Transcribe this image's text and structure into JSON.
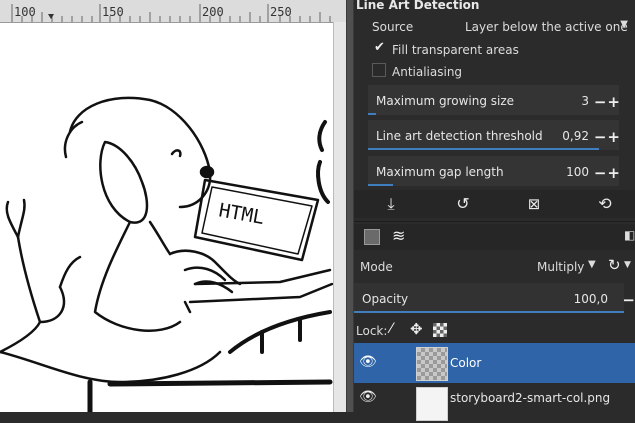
{
  "ruler": {
    "labels": [
      "100",
      "150",
      "200",
      "250"
    ]
  },
  "line_art": {
    "title": "Line Art Detection",
    "source_label": "Source",
    "source_value": "Layer below the active one",
    "fill_transparent_label": "Fill transparent areas",
    "fill_transparent_checked": true,
    "antialiasing_label": "Antialiasing",
    "antialiasing_checked": false,
    "max_growing": {
      "label": "Maximum growing size",
      "value": "3",
      "fraction": 0.03
    },
    "threshold": {
      "label": "Line art detection threshold",
      "value": "0,92",
      "fraction": 0.92
    },
    "max_gap": {
      "label": "Maximum gap length",
      "value": "100",
      "fraction": 0.1
    },
    "plus_minus": "−+",
    "button_icons": [
      "import-icon",
      "reset-icon",
      "delete-icon",
      "refresh-icon"
    ]
  },
  "layers": {
    "mode_label": "Mode",
    "mode_value": "Multiply",
    "opacity_label": "Opacity",
    "opacity_value": "100,0",
    "opacity_fraction": 1.0,
    "lock_label": "Lock:",
    "items": [
      {
        "name": "Color",
        "selected": true,
        "visible": true
      },
      {
        "name": "storyboard2-smart-col.png",
        "selected": false,
        "visible": true
      }
    ]
  },
  "colors": {
    "accent": "#3f7fbf",
    "selected_row": "#2f65a8",
    "panel": "#2b2b2b"
  }
}
